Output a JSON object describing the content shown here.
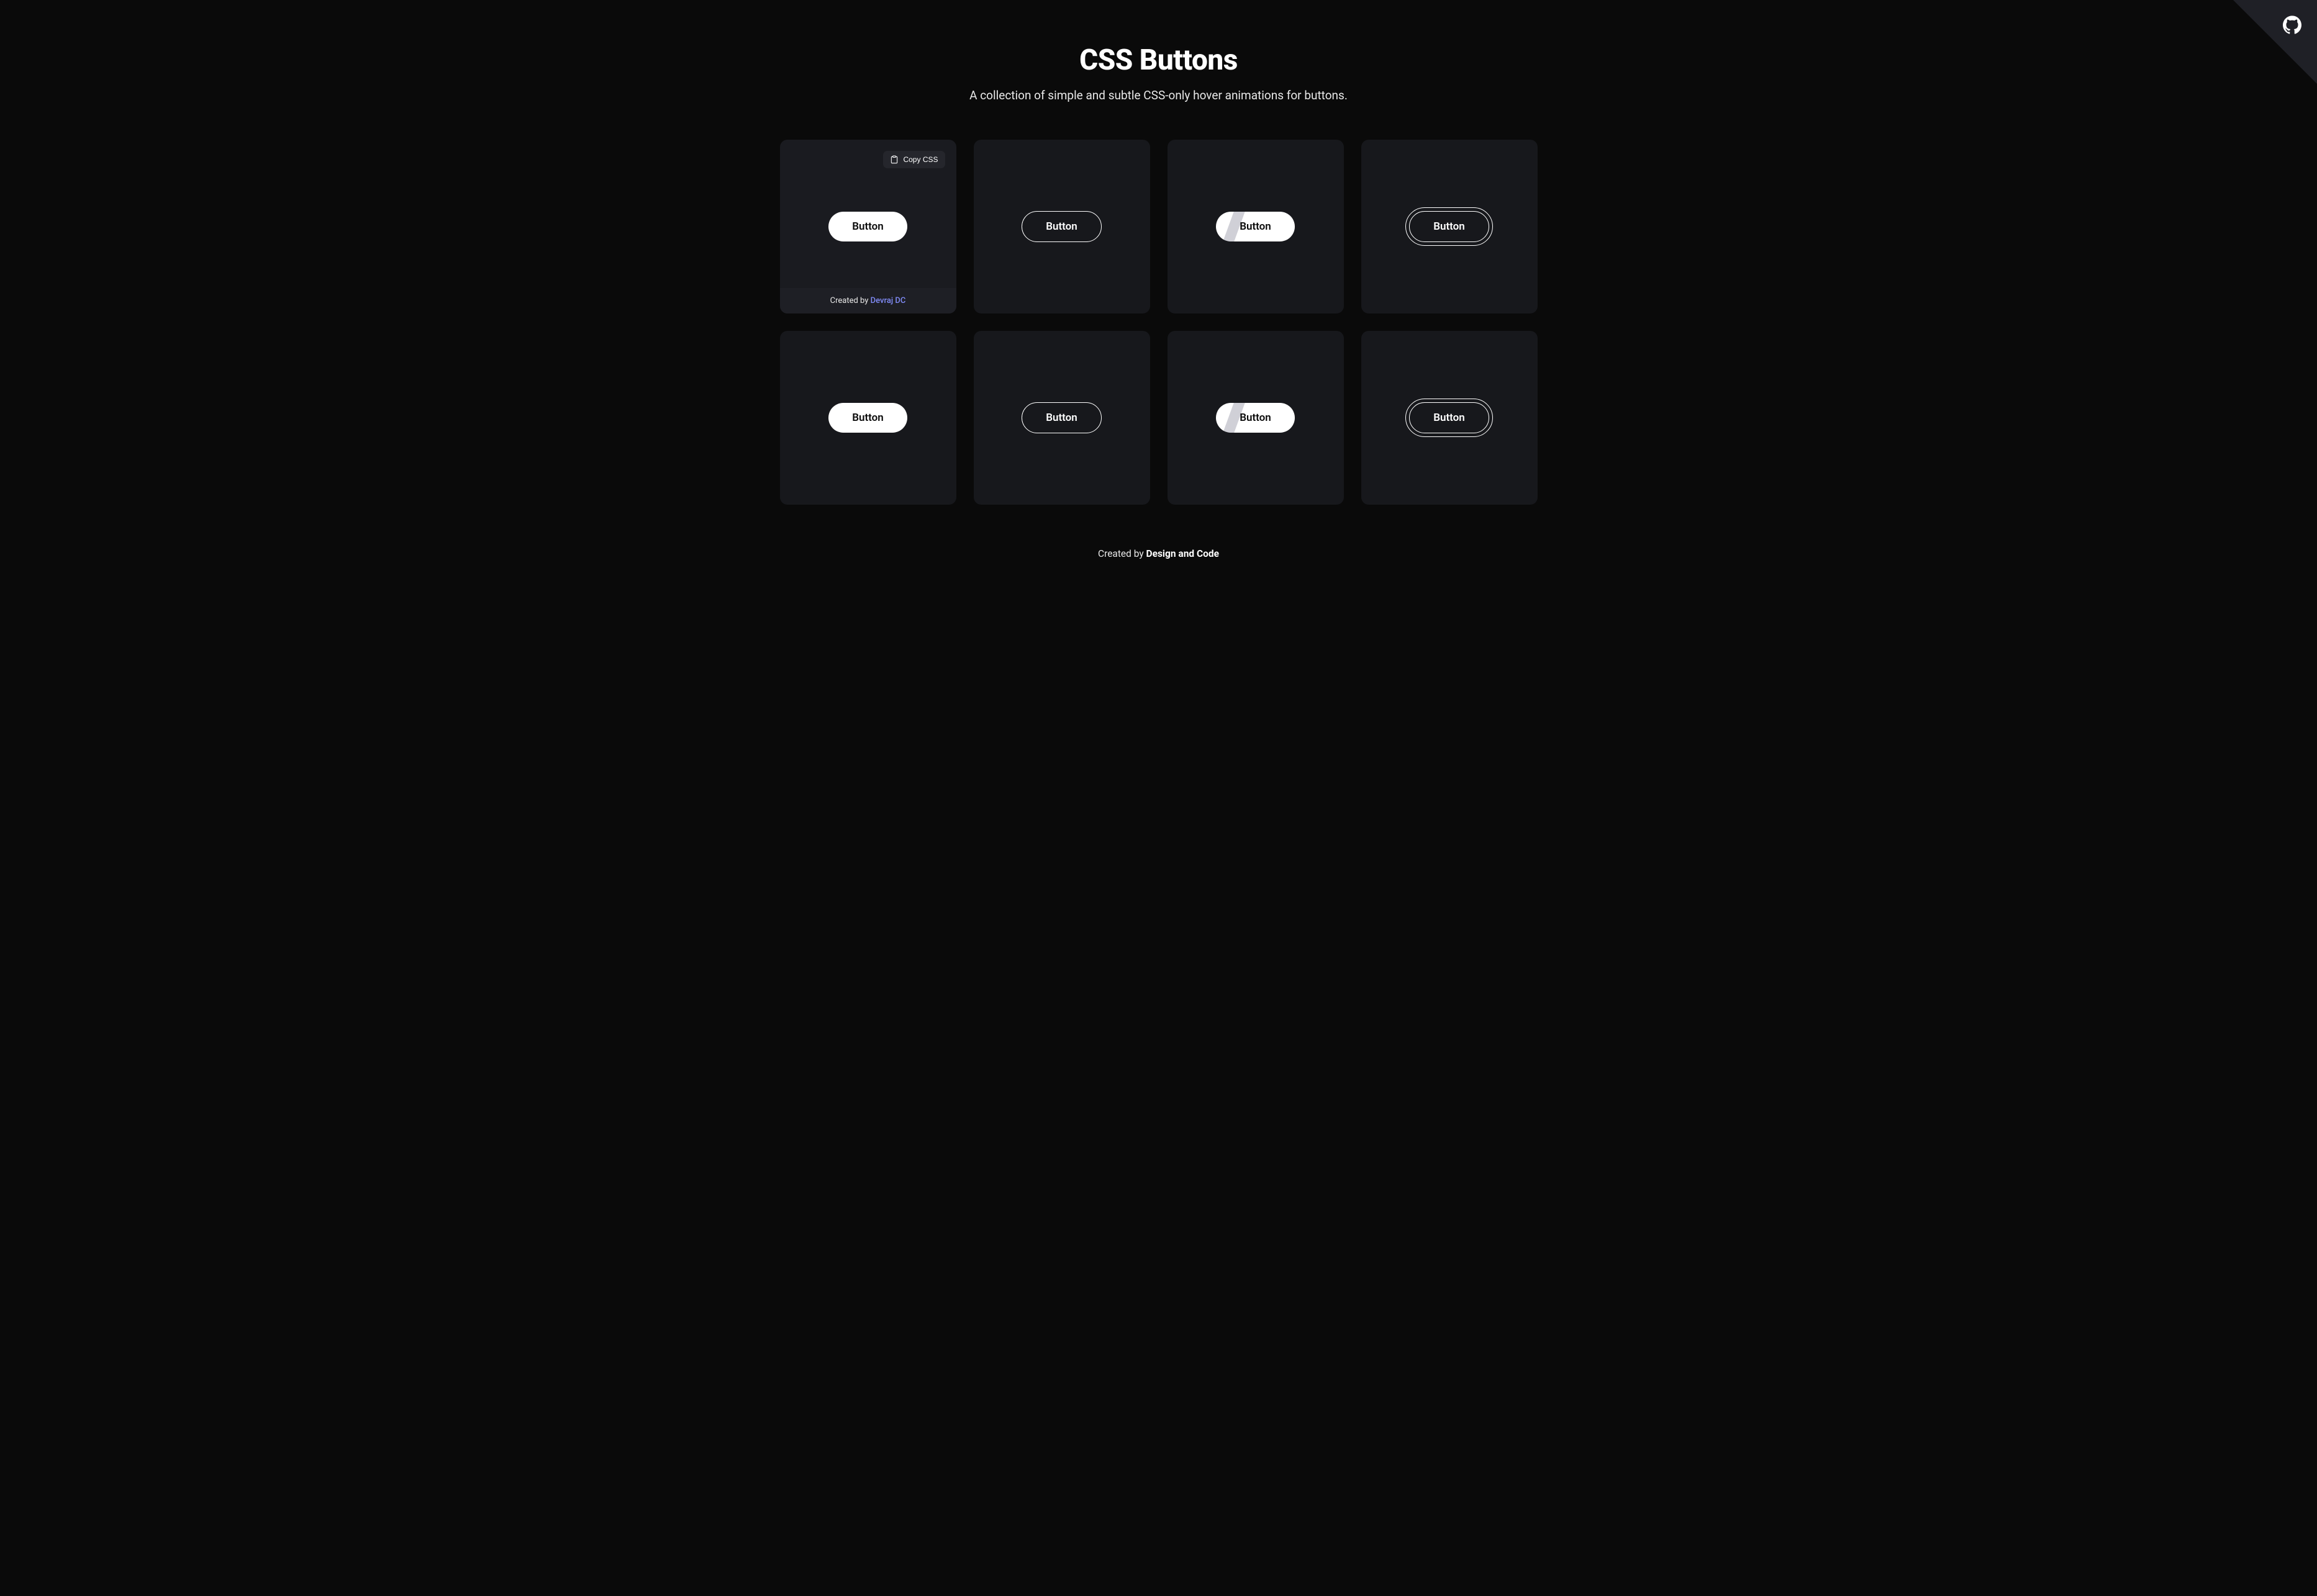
{
  "header": {
    "title": "CSS Buttons",
    "subtitle": "A collection of simple and subtle CSS-only hover animations for buttons."
  },
  "copy_button": {
    "label": "Copy CSS"
  },
  "card_footer": {
    "prefix": "Created by ",
    "author": "Devraj DC"
  },
  "buttons": {
    "label": "Button"
  },
  "cards": [
    {
      "type": "filled",
      "hovered": true
    },
    {
      "type": "outline",
      "hovered": false
    },
    {
      "type": "stripe",
      "hovered": false
    },
    {
      "type": "double-outline",
      "hovered": false
    },
    {
      "type": "filled",
      "hovered": false
    },
    {
      "type": "outline",
      "hovered": false
    },
    {
      "type": "stripe",
      "hovered": false
    },
    {
      "type": "double-outline",
      "hovered": false
    }
  ],
  "footer": {
    "prefix": "Created by ",
    "author": "Design and Code"
  }
}
